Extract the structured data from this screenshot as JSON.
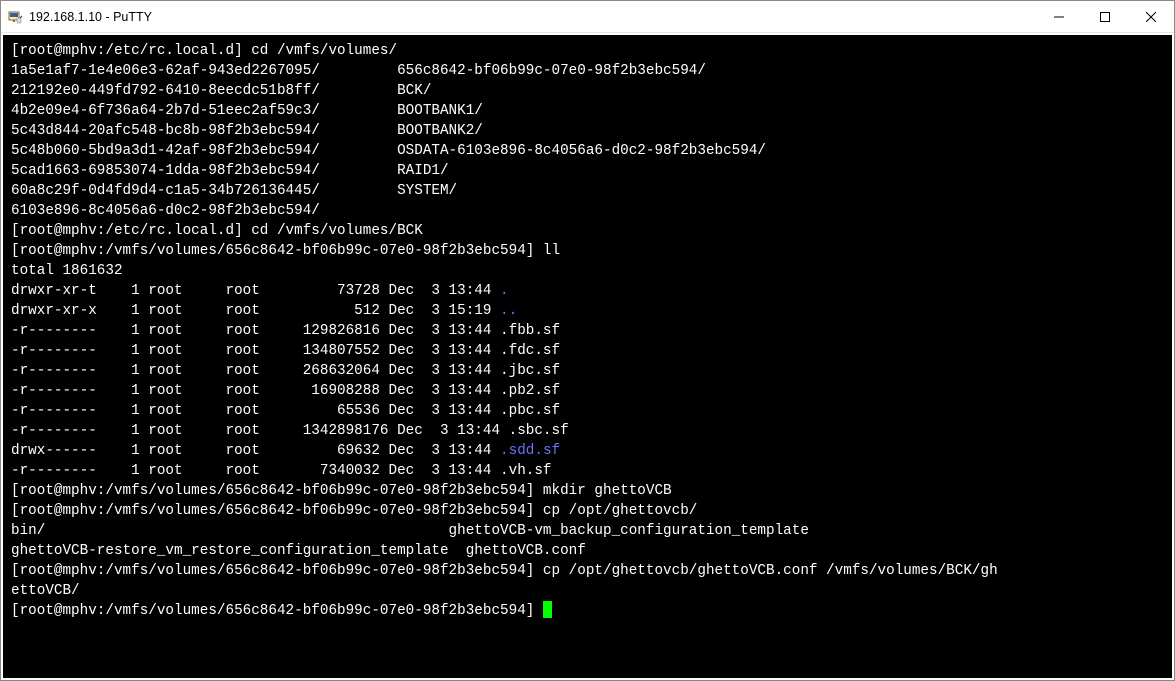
{
  "window": {
    "title": "192.168.1.10 - PuTTY"
  },
  "terminal": {
    "lines": [
      {
        "segments": [
          {
            "t": "[root@mphv:/etc/rc.local.d] cd /vmfs/volumes/"
          }
        ]
      },
      {
        "segments": [
          {
            "t": "1a5e1af7-1e4e06e3-62af-943ed2267095/         656c8642-bf06b99c-07e0-98f2b3ebc594/"
          }
        ]
      },
      {
        "segments": [
          {
            "t": "212192e0-449fd792-6410-8eecdc51b8ff/         BCK/"
          }
        ]
      },
      {
        "segments": [
          {
            "t": "4b2e09e4-6f736a64-2b7d-51eec2af59c3/         BOOTBANK1/"
          }
        ]
      },
      {
        "segments": [
          {
            "t": "5c43d844-20afc548-bc8b-98f2b3ebc594/         BOOTBANK2/"
          }
        ]
      },
      {
        "segments": [
          {
            "t": "5c48b060-5bd9a3d1-42af-98f2b3ebc594/         OSDATA-6103e896-8c4056a6-d0c2-98f2b3ebc594/"
          }
        ]
      },
      {
        "segments": [
          {
            "t": "5cad1663-69853074-1dda-98f2b3ebc594/         RAID1/"
          }
        ]
      },
      {
        "segments": [
          {
            "t": "60a8c29f-0d4fd9d4-c1a5-34b726136445/         SYSTEM/"
          }
        ]
      },
      {
        "segments": [
          {
            "t": "6103e896-8c4056a6-d0c2-98f2b3ebc594/"
          }
        ]
      },
      {
        "segments": [
          {
            "t": "[root@mphv:/etc/rc.local.d] cd /vmfs/volumes/BCK"
          }
        ]
      },
      {
        "segments": [
          {
            "t": "[root@mphv:/vmfs/volumes/656c8642-bf06b99c-07e0-98f2b3ebc594] ll"
          }
        ]
      },
      {
        "segments": [
          {
            "t": "total 1861632"
          }
        ]
      },
      {
        "segments": [
          {
            "t": "drwxr-xr-t    1 root     root         73728 Dec  3 13:44 "
          },
          {
            "t": ".",
            "c": "blue"
          }
        ]
      },
      {
        "segments": [
          {
            "t": "drwxr-xr-x    1 root     root           512 Dec  3 15:19 "
          },
          {
            "t": "..",
            "c": "blue"
          }
        ]
      },
      {
        "segments": [
          {
            "t": "-r--------    1 root     root     129826816 Dec  3 13:44 .fbb.sf"
          }
        ]
      },
      {
        "segments": [
          {
            "t": "-r--------    1 root     root     134807552 Dec  3 13:44 .fdc.sf"
          }
        ]
      },
      {
        "segments": [
          {
            "t": "-r--------    1 root     root     268632064 Dec  3 13:44 .jbc.sf"
          }
        ]
      },
      {
        "segments": [
          {
            "t": "-r--------    1 root     root      16908288 Dec  3 13:44 .pb2.sf"
          }
        ]
      },
      {
        "segments": [
          {
            "t": "-r--------    1 root     root         65536 Dec  3 13:44 .pbc.sf"
          }
        ]
      },
      {
        "segments": [
          {
            "t": "-r--------    1 root     root     1342898176 Dec  3 13:44 .sbc.sf"
          }
        ]
      },
      {
        "segments": [
          {
            "t": "drwx------    1 root     root         69632 Dec  3 13:44 "
          },
          {
            "t": ".sdd.sf",
            "c": "blue"
          }
        ]
      },
      {
        "segments": [
          {
            "t": "-r--------    1 root     root       7340032 Dec  3 13:44 .vh.sf"
          }
        ]
      },
      {
        "segments": [
          {
            "t": "[root@mphv:/vmfs/volumes/656c8642-bf06b99c-07e0-98f2b3ebc594] mkdir ghettoVCB"
          }
        ]
      },
      {
        "segments": [
          {
            "t": "[root@mphv:/vmfs/volumes/656c8642-bf06b99c-07e0-98f2b3ebc594] cp /opt/ghettovcb/"
          }
        ]
      },
      {
        "segments": [
          {
            "t": "bin/                                               ghettoVCB-vm_backup_configuration_template"
          }
        ]
      },
      {
        "segments": [
          {
            "t": "ghettoVCB-restore_vm_restore_configuration_template  ghettoVCB.conf"
          }
        ]
      },
      {
        "segments": [
          {
            "t": "[root@mphv:/vmfs/volumes/656c8642-bf06b99c-07e0-98f2b3ebc594] cp /opt/ghettovcb/ghettoVCB.conf /vmfs/volumes/BCK/gh"
          }
        ]
      },
      {
        "segments": [
          {
            "t": "ettoVCB/"
          }
        ]
      },
      {
        "segments": [
          {
            "t": "[root@mphv:/vmfs/volumes/656c8642-bf06b99c-07e0-98f2b3ebc594] "
          }
        ],
        "cursor": true
      }
    ]
  }
}
